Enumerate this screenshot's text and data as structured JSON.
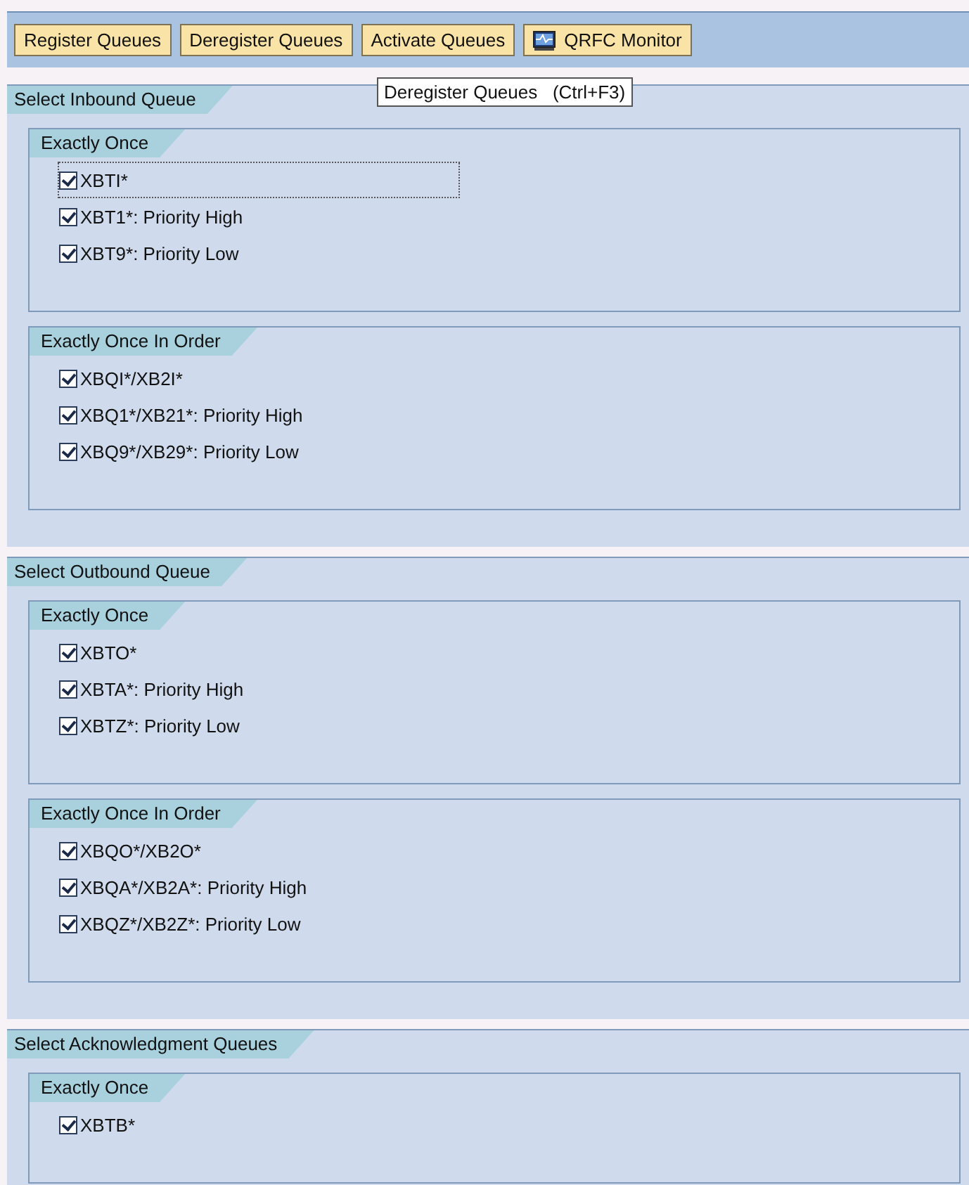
{
  "toolbar": {
    "buttons": [
      {
        "label": "Register Queues",
        "kind": "text"
      },
      {
        "label": "Deregister Queues",
        "kind": "text"
      },
      {
        "label": "Activate Queues",
        "kind": "text"
      },
      {
        "label": "QRFC Monitor",
        "kind": "monitor"
      }
    ]
  },
  "tooltip": "Deregister Queues   (Ctrl+F3)",
  "sections": [
    {
      "title": "Select Inbound Queue",
      "groups": [
        {
          "title": "Exactly Once",
          "items": [
            {
              "label": "XBTI*",
              "checked": true,
              "focused": true
            },
            {
              "label": "XBT1*: Priority High",
              "checked": true,
              "focused": false
            },
            {
              "label": "XBT9*: Priority  Low",
              "checked": true,
              "focused": false
            }
          ]
        },
        {
          "title": "Exactly Once In Order",
          "items": [
            {
              "label": "XBQI*/XB2I*",
              "checked": true,
              "focused": false
            },
            {
              "label": "XBQ1*/XB21*: Priority High",
              "checked": true,
              "focused": false
            },
            {
              "label": "XBQ9*/XB29*: Priority  Low",
              "checked": true,
              "focused": false
            }
          ]
        }
      ]
    },
    {
      "title": "Select Outbound Queue",
      "groups": [
        {
          "title": "Exactly Once",
          "items": [
            {
              "label": "XBTO*",
              "checked": true,
              "focused": false
            },
            {
              "label": "XBTA*: Priority High",
              "checked": true,
              "focused": false
            },
            {
              "label": "XBTZ*: Priority Low",
              "checked": true,
              "focused": false
            }
          ]
        },
        {
          "title": "Exactly Once In Order",
          "items": [
            {
              "label": "XBQO*/XB2O*",
              "checked": true,
              "focused": false
            },
            {
              "label": "XBQA*/XB2A*: Priority High",
              "checked": true,
              "focused": false
            },
            {
              "label": "XBQZ*/XB2Z*: Priority Low",
              "checked": true,
              "focused": false
            }
          ]
        }
      ]
    },
    {
      "title": "Select Acknowledgment Queues",
      "groups": [
        {
          "title": "Exactly Once",
          "items": [
            {
              "label": "XBTB*",
              "checked": true,
              "focused": false
            }
          ]
        }
      ]
    }
  ]
}
